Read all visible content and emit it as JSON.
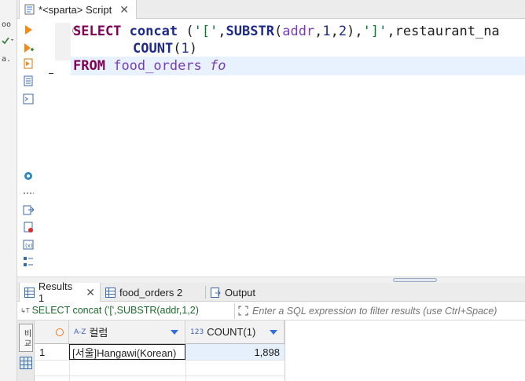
{
  "editor_tab": {
    "title": "*<sparta> Script",
    "close": "✕"
  },
  "left_edge": {
    "glyphs": [
      "oo",
      "a."
    ]
  },
  "editor": {
    "line1": {
      "select": "SELECT",
      "concat": "concat",
      "rest_a": " ('['",
      "comma1": ",",
      "substr": "SUBSTR",
      "paren": "(",
      "addr": "addr",
      "c2": ",",
      "n1": "1",
      "c3": ",",
      "n2": "2",
      "rest_b": "),",
      "str2": "']'",
      "rest_c": ",restaurant_na"
    },
    "line2": {
      "count": "COUNT",
      "open": "(",
      "n": "1",
      "close": ")"
    },
    "line3": {
      "from": "FROM",
      "table": "food_orders",
      "alias": "fo"
    }
  },
  "result_tabs": [
    {
      "label": "Results 1",
      "close": "✕",
      "active": true
    },
    {
      "label": "food_orders 2",
      "active": false
    },
    {
      "label": "Output",
      "active": false
    }
  ],
  "filter_bar": {
    "query_text": "SELECT concat ('[',SUBSTR(addr,1,2)",
    "placeholder": "Enter a SQL expression to filter results (use Ctrl+Space)"
  },
  "grid": {
    "vertical_tab_label": "비 교",
    "columns": [
      {
        "type_icon": "A-Z",
        "label": "컬럼"
      },
      {
        "type_icon": "123",
        "label": "COUNT(1)"
      }
    ],
    "rows": [
      {
        "num": "1",
        "col1": "[서울]Hangawi(Korean)",
        "col2": "1,898"
      }
    ]
  },
  "colors": {
    "keyword": "#7f0055",
    "function": "#1d2a8a",
    "string": "#0a7a2f",
    "identifier": "#7a3bb8",
    "current_line": "#e8f2fe",
    "selected_cell": "#e6f0fc"
  }
}
